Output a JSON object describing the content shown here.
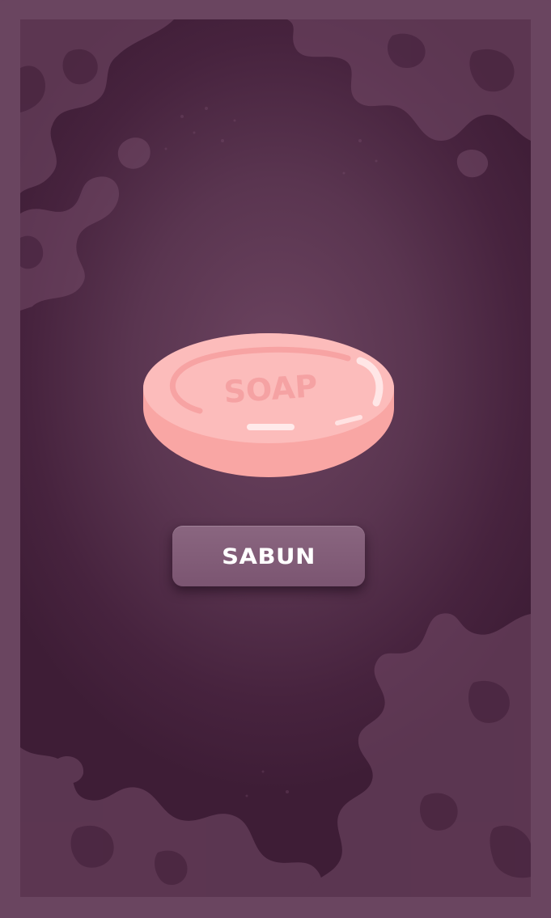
{
  "item": {
    "name": "SABUN",
    "image_text": "SOAP",
    "image_icon": "soap-bar"
  },
  "colors": {
    "frame": "#6a4560",
    "background_center": "#6c4460",
    "background_edge": "#3e1d36",
    "button": "#7b5571",
    "soap": "#fcb7b5",
    "soap_side": "#f9a6a4"
  }
}
